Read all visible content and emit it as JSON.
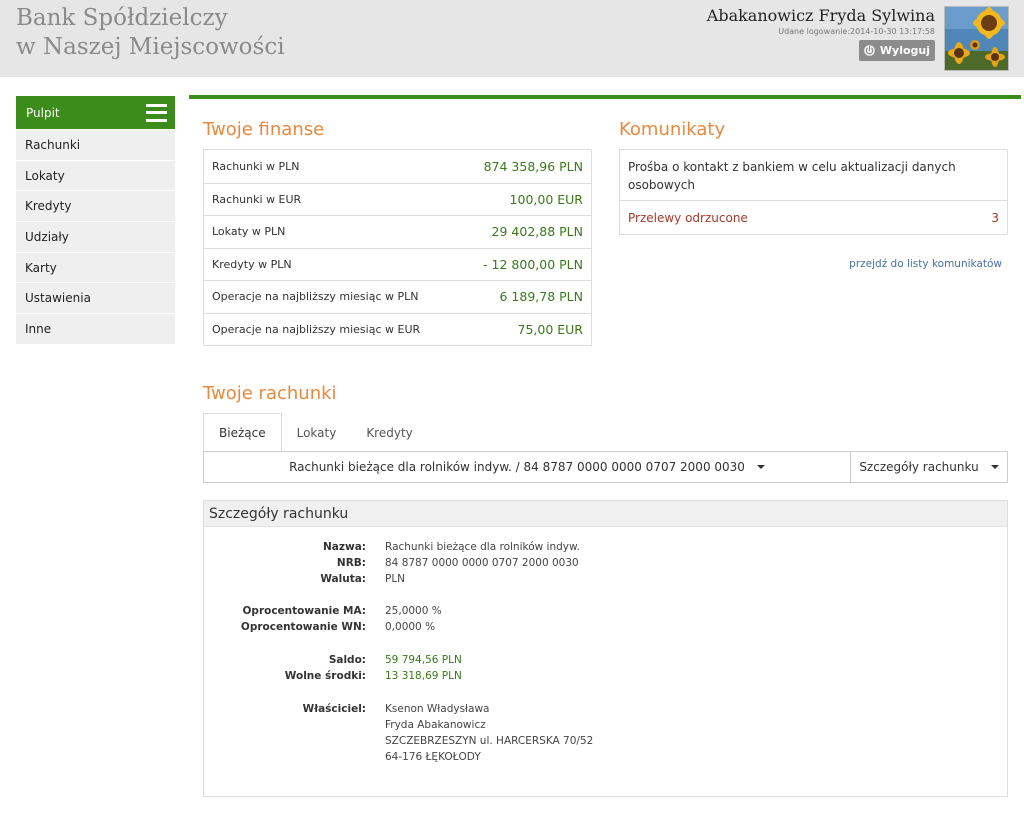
{
  "header": {
    "bank_line1": "Bank Spółdzielczy",
    "bank_line2": "w Naszej Miejscowości",
    "user_name": "Abakanowicz Fryda Sylwina",
    "last_login": "Udane logowanie:2014-10-30 13:17:58",
    "logout_label": "Wyloguj",
    "logout_icon": "power-icon"
  },
  "sidebar": {
    "active": "Pulpit",
    "menu_icon": "hamburger-icon",
    "items": [
      "Rachunki",
      "Lokaty",
      "Kredyty",
      "Udziały",
      "Karty",
      "Ustawienia",
      "Inne"
    ]
  },
  "finances": {
    "title": "Twoje finanse",
    "rows": [
      {
        "label": "Rachunki w PLN",
        "value": "874 358,96 PLN"
      },
      {
        "label": "Rachunki w EUR",
        "value": "100,00 EUR"
      },
      {
        "label": "Lokaty w PLN",
        "value": "29 402,88 PLN"
      },
      {
        "label": "Kredyty w PLN",
        "value": "- 12 800,00 PLN"
      },
      {
        "label": "Operacje na najbliższy miesiąc w PLN",
        "value": "6 189,78 PLN"
      },
      {
        "label": "Operacje na najbliższy miesiąc w EUR",
        "value": "75,00 EUR"
      }
    ]
  },
  "messages": {
    "title": "Komunikaty",
    "contact_request": "Prośba o kontakt z bankiem w celu aktualizacji danych osobowych",
    "rejected_label": "Przelewy odrzucone",
    "rejected_count": "3",
    "list_link": "przejdź do listy komunikatów"
  },
  "accounts": {
    "title": "Twoje rachunki",
    "tabs": [
      "Bieżące",
      "Lokaty",
      "Kredyty"
    ],
    "selected_account": "Rachunki bieżące dla rolników indyw. / 84 8787 0000 0000 0707 2000 0030",
    "details_button": "Szczegóły rachunku"
  },
  "details": {
    "title": "Szczegóły rachunku",
    "name_label": "Nazwa:",
    "name": "Rachunki bieżące dla rolników indyw.",
    "nrb_label": "NRB:",
    "nrb": "84 8787 0000 0000 0707 2000 0030",
    "currency_label": "Waluta:",
    "currency": "PLN",
    "rate_ma_label": "Oprocentowanie MA:",
    "rate_ma": "25,0000 %",
    "rate_wn_label": "Oprocentowanie WN:",
    "rate_wn": "0,0000 %",
    "balance_label": "Saldo:",
    "balance": "59 794,56 PLN",
    "available_label": "Wolne środki:",
    "available": "13 318,69 PLN",
    "owner_label": "Właściciel:",
    "owner_lines": [
      "Ksenon Władysława",
      "Fryda Abakanowicz",
      "SZCZEBRZESZYN ul. HARCERSKA 70/52",
      "64-176 ŁĘKOŁODY"
    ]
  },
  "colors": {
    "accent_green": "#3c8c1c",
    "section_orange": "#e8893d",
    "value_green": "#3a7a1a",
    "alert_red": "#a33a2a",
    "link_blue": "#4a6fa5"
  }
}
